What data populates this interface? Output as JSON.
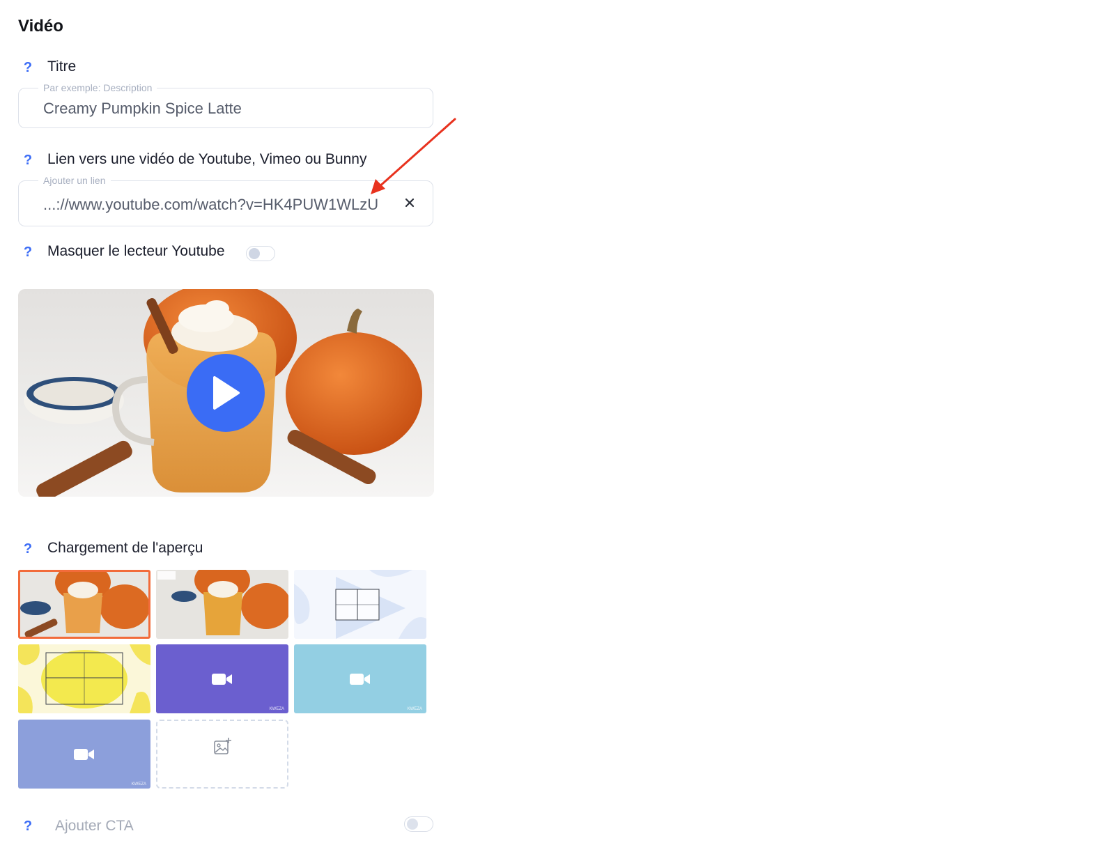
{
  "section": {
    "title": "Vidéo"
  },
  "help_icon": "?",
  "title_field": {
    "label": "Titre",
    "legend": "Par exemple: Description",
    "value": "Creamy Pumpkin Spice Latte"
  },
  "link_field": {
    "label": "Lien vers une vidéo de Youtube, Vimeo ou Bunny",
    "legend": "Ajouter un lien",
    "value": "...://www.youtube.com/watch?v=HK4PUW1WLzU",
    "clear_icon": "close-icon"
  },
  "hide_player": {
    "label": "Masquer le lecteur Youtube",
    "enabled": false
  },
  "preview": {
    "play_icon": "play-icon"
  },
  "thumbnail_section": {
    "label": "Chargement de l'aperçu",
    "thumbnails": [
      {
        "kind": "photo",
        "selected": true
      },
      {
        "kind": "photo-labeled",
        "selected": false
      },
      {
        "kind": "illustration-blue",
        "selected": false
      },
      {
        "kind": "illustration-yellow",
        "selected": false
      },
      {
        "kind": "video-placeholder",
        "color": "#6b5fcf",
        "brand": "KWEZA",
        "selected": false
      },
      {
        "kind": "video-placeholder",
        "color": "#93cfe3",
        "brand": "KWEZA",
        "selected": false
      },
      {
        "kind": "video-placeholder",
        "color": "#8c9fdb",
        "brand": "KWEZA",
        "selected": false
      },
      {
        "kind": "add-image",
        "icon": "image-add-icon",
        "selected": false
      }
    ]
  },
  "cta": {
    "label": "Ajouter CTA",
    "enabled": false
  },
  "colors": {
    "accent": "#3b6cf6",
    "selected_border": "#f26b3a",
    "annotation_arrow": "#e8321e"
  }
}
